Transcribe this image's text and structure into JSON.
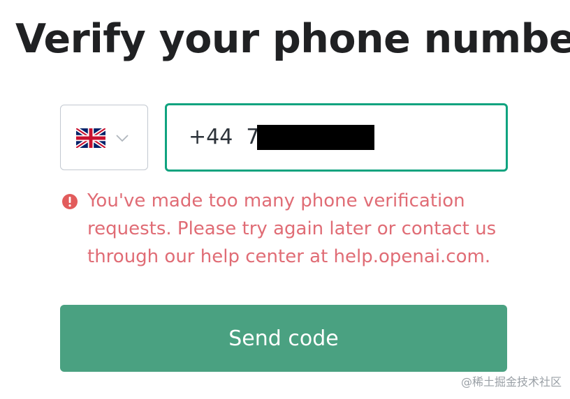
{
  "page": {
    "title": "Verify your phone number"
  },
  "country_select": {
    "flag_icon": "uk-flag-icon",
    "chevron_icon": "chevron-down-icon"
  },
  "phone": {
    "value": "+44  7"
  },
  "error": {
    "icon": "alert-circle-icon",
    "lines": [
      "You've made too many phone verification",
      "requests. Please try again later or contact us",
      "through our help center at help.openai.com."
    ]
  },
  "actions": {
    "send_label": "Send code"
  },
  "watermark": "@稀土掘金技术社区",
  "colors": {
    "accent": "#10a37f",
    "button": "#4aa181",
    "error": "#e06c75",
    "title": "#202123"
  }
}
